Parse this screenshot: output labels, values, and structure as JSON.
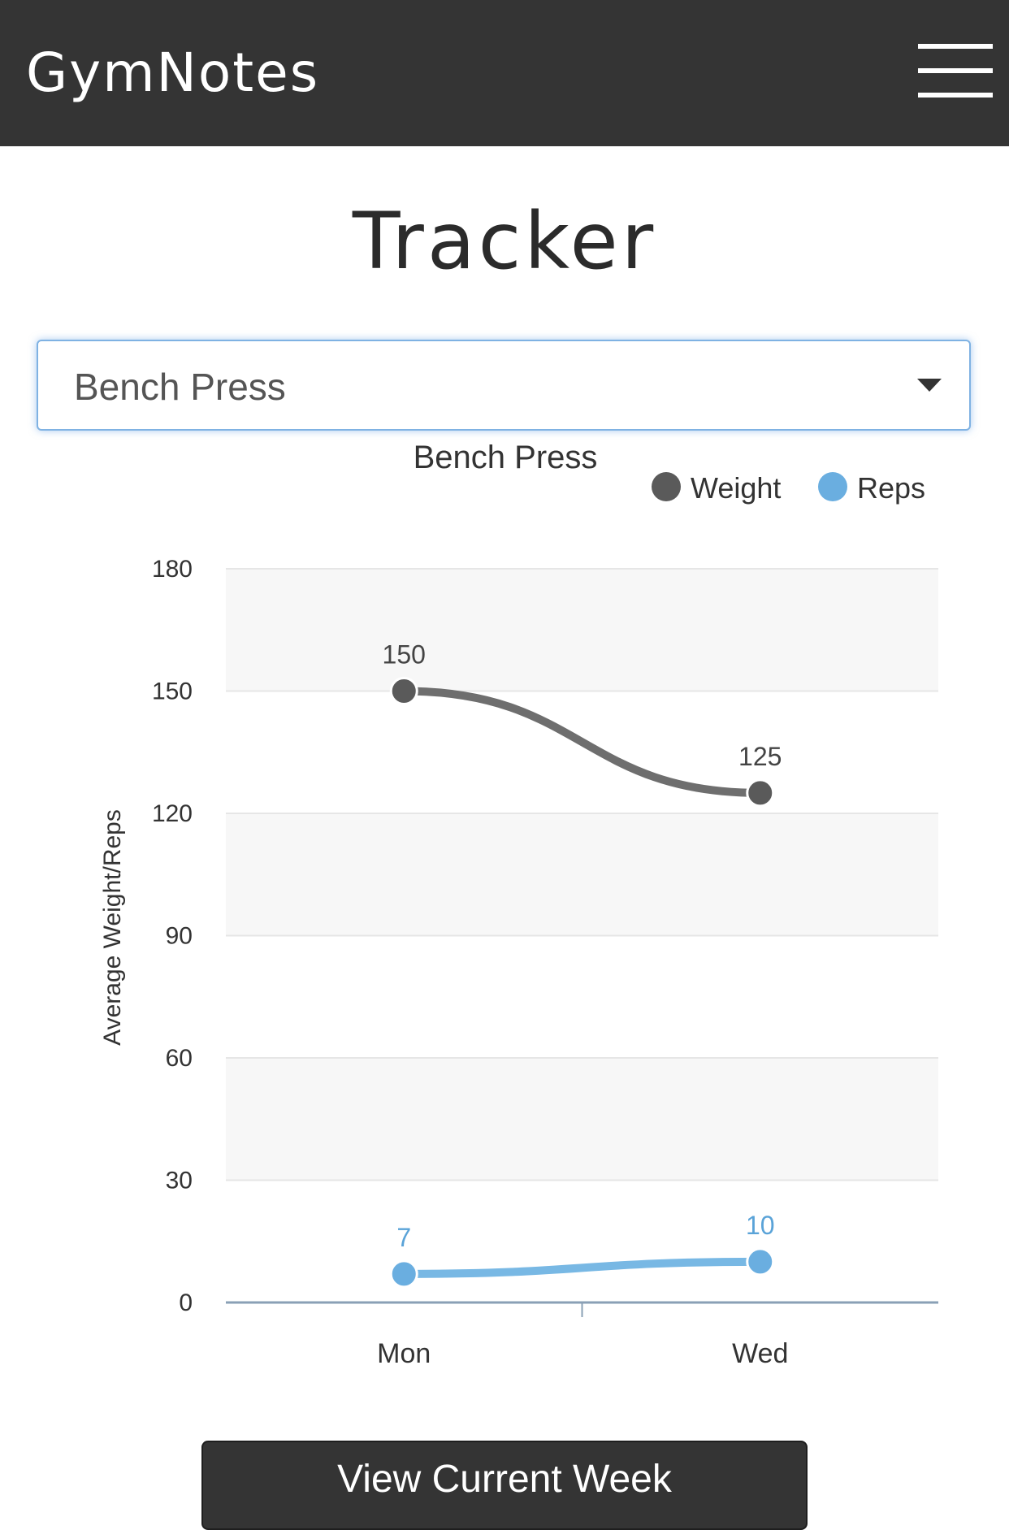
{
  "app": {
    "brand": "GymNotes",
    "menu_icon": "hamburger-menu-icon"
  },
  "page": {
    "title": "Tracker"
  },
  "exercise_select": {
    "selected": "Bench Press",
    "caret_icon": "caret-down-icon"
  },
  "chart_data": {
    "type": "line",
    "title": "Bench Press",
    "categories": [
      "Mon",
      "Wed"
    ],
    "ylabel": "Average Weight/Reps",
    "xlabel": "",
    "ylim": [
      0,
      180
    ],
    "yticks": [
      0,
      30,
      60,
      90,
      120,
      150,
      180
    ],
    "legend": "top-right",
    "grid": true,
    "series": [
      {
        "name": "Weight",
        "values": [
          150,
          125
        ],
        "color": "#5a5a5a",
        "line_color": "#6e6e6e",
        "label_color": "#444444"
      },
      {
        "name": "Reps",
        "values": [
          7,
          10
        ],
        "color": "#6aaee0",
        "line_color": "#78b8e4",
        "label_color": "#5aa3d8"
      }
    ]
  },
  "actions": {
    "view_week": "View Current Week"
  }
}
